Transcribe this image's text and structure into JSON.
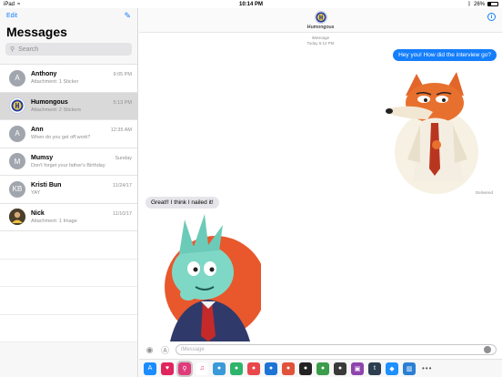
{
  "status_bar": {
    "device": "iPad",
    "time": "10:14 PM",
    "battery": "26%"
  },
  "sidebar": {
    "edit_label": "Edit",
    "title": "Messages",
    "search_placeholder": "Search",
    "conversations": [
      {
        "initials": "A",
        "name": "Anthony",
        "time": "9:05 PM",
        "preview": "Attachment: 1 Sticker"
      },
      {
        "initials": "",
        "name": "Humongous",
        "time": "5:13 PM",
        "preview": "Attachment: 2 Stickers"
      },
      {
        "initials": "A",
        "name": "Ann",
        "time": "12:35 AM",
        "preview": "When do you get off work?"
      },
      {
        "initials": "M",
        "name": "Mumsy",
        "time": "Sunday",
        "preview": "Don't forget your father's Birthday"
      },
      {
        "initials": "KB",
        "name": "Kristi Bun",
        "time": "11/24/17",
        "preview": "YAY"
      },
      {
        "initials": "",
        "name": "Nick",
        "time": "11/10/17",
        "preview": "Attachment: 1 Image"
      }
    ]
  },
  "chat": {
    "contact_name": "Humongous",
    "meta_service": "iMessage",
    "meta_time": "Today 5:12 PM",
    "outgoing_text": "Hey you! How did the interview go?",
    "delivered_label": "Delivered",
    "incoming_text": "Great!! I think I nailed it!",
    "input_placeholder": "iMessage"
  },
  "app_drawer": {
    "colors": [
      "#1a8cff",
      "#e0245e",
      "#e03a7a",
      "#ffffff",
      "#3a9ad9",
      "#2eb36b",
      "#e8474c",
      "#1d74d6",
      "#e0523a",
      "#222222",
      "#3b9c4a",
      "#3a3a3a",
      "#8e44ad",
      "#2c3e50",
      "#1e90ff",
      "#2a7fd4"
    ]
  }
}
